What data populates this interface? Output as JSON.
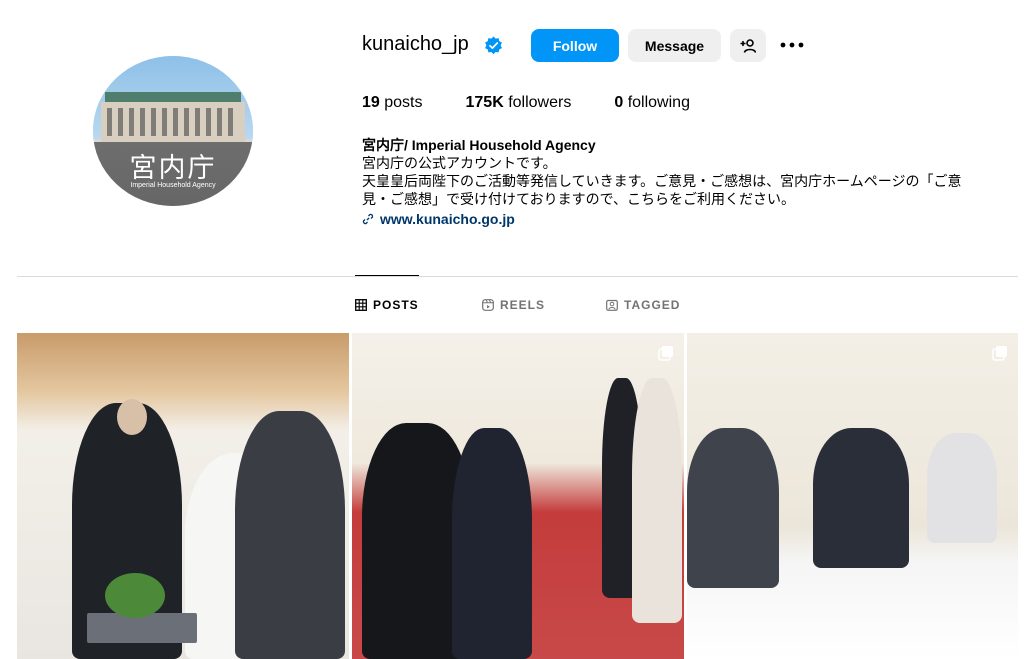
{
  "profile": {
    "username": "kunaicho_jp",
    "avatar_kanji": "宮内庁",
    "avatar_subtitle": "Imperial Household Agency"
  },
  "actions": {
    "follow_label": "Follow",
    "message_label": "Message"
  },
  "stats": {
    "posts_count": "19",
    "posts_label": "posts",
    "followers_count": "175K",
    "followers_label": "followers",
    "following_count": "0",
    "following_label": "following"
  },
  "bio": {
    "name": "宮内庁/ Imperial Household Agency",
    "line1": "宮内庁の公式アカウントです。",
    "line2": "天皇皇后両陛下のご活動等発信していきます。ご意見・ご感想は、宮内庁ホームページの「ご意",
    "line3": "見・ご感想」で受け付けておりますので、こちらをご利用ください。",
    "link": "www.kunaicho.go.jp"
  },
  "tabs": [
    {
      "label": "POSTS",
      "icon": "grid-icon",
      "active": true
    },
    {
      "label": "REELS",
      "icon": "reels-icon",
      "active": false
    },
    {
      "label": "TAGGED",
      "icon": "tagged-icon",
      "active": false
    }
  ],
  "colors": {
    "follow_button": "#0095f6",
    "secondary_button": "#efefef",
    "link": "#00376b",
    "verified_badge": "#0095f6"
  }
}
